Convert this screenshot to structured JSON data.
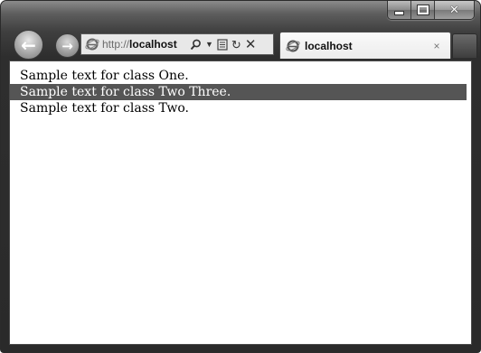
{
  "window": {
    "controls": {
      "minimize": "",
      "maximize": "",
      "close": "✕"
    }
  },
  "addressbar": {
    "url_protocol": "http://",
    "url_host": "localhost"
  },
  "tab": {
    "title": "localhost",
    "close_glyph": "×"
  },
  "content": {
    "lines": [
      {
        "text": "Sample text for class One.",
        "highlighted": false
      },
      {
        "text": "Sample text for class Two Three.",
        "highlighted": true
      },
      {
        "text": "Sample text for class Two.",
        "highlighted": false
      }
    ]
  },
  "colors": {
    "highlight_bg": "#555555",
    "highlight_fg": "#ffffff",
    "chrome_dark": "#2e2e2e"
  }
}
